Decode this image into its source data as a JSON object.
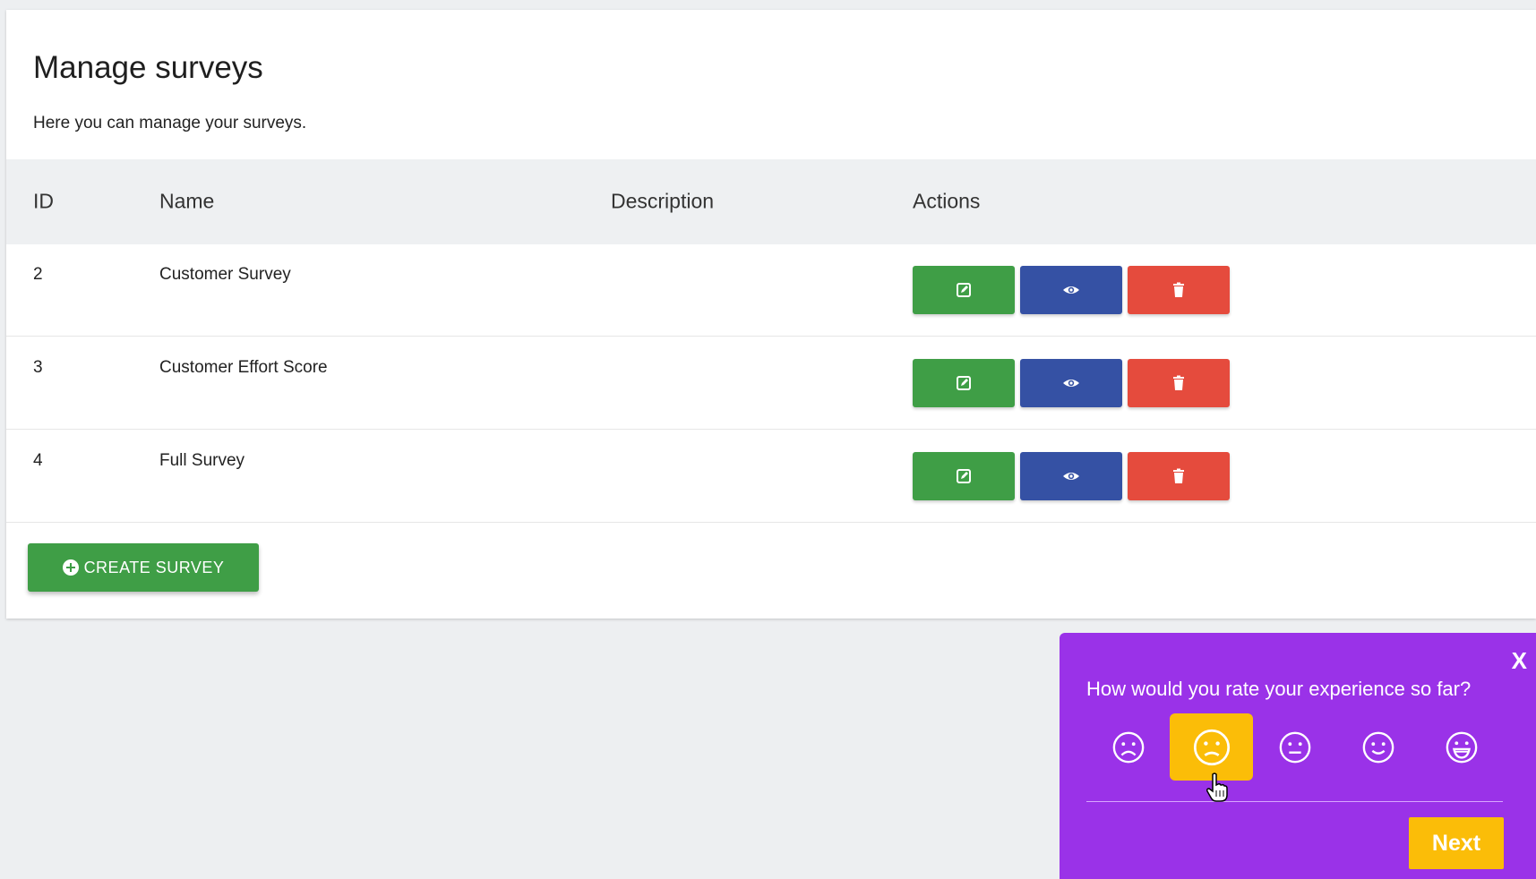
{
  "page": {
    "title": "Manage surveys",
    "subtitle": "Here you can manage your surveys."
  },
  "table": {
    "headers": [
      "ID",
      "Name",
      "Description",
      "Actions"
    ],
    "rows": [
      {
        "id": "2",
        "name": "Customer Survey",
        "description": ""
      },
      {
        "id": "3",
        "name": "Customer Effort Score",
        "description": ""
      },
      {
        "id": "4",
        "name": "Full Survey",
        "description": ""
      }
    ],
    "action_icons": [
      "edit-icon",
      "eye-icon",
      "trash-icon"
    ]
  },
  "create_button": {
    "label": "CREATE SURVEY",
    "icon": "plus-circle-icon"
  },
  "widget": {
    "close_label": "X",
    "question": "How would you rate your experience so far?",
    "ratings": [
      "very-sad-face-icon",
      "sad-face-icon",
      "neutral-face-icon",
      "smile-face-icon",
      "grin-face-icon"
    ],
    "selected_rating_index": 1,
    "next_label": "Next"
  },
  "colors": {
    "edit": "#3f9e46",
    "view": "#3551a4",
    "delete": "#e54b3d",
    "widget_bg": "#9a32e8",
    "widget_accent": "#fbbd08"
  }
}
